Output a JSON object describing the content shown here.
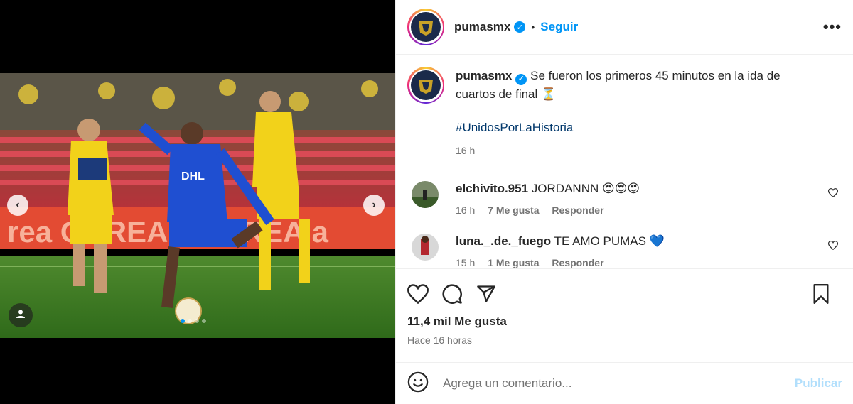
{
  "post": {
    "username": "pumasmx",
    "follow_label": "Seguir",
    "separator": "•",
    "more_label": "•••",
    "caption": "Se fueron los primeros 45 minutos en la ida de cuartos de final ⏳",
    "hashtag": "#UnidosPorLaHistoria",
    "caption_time": "16 h",
    "likes": "11,4 mil Me gusta",
    "time_ago": "Hace 16 horas"
  },
  "media": {
    "prev_label": "‹",
    "next_label": "›",
    "slide_count": 4,
    "active_slide": 1
  },
  "comments": [
    {
      "username": "elchivito.951",
      "text": "JORDANNN 😍😍😍",
      "time": "16 h",
      "likes": "7 Me gusta",
      "reply": "Responder"
    },
    {
      "username": "luna._.de._fuego",
      "text": "TE AMO PUMAS 💙",
      "time": "15 h",
      "likes": "1 Me gusta",
      "reply": "Responder"
    }
  ],
  "add_comment": {
    "placeholder": "Agrega un comentario...",
    "post_label": "Publicar"
  },
  "colors": {
    "accent": "#0095f6",
    "hashtag": "#00376b",
    "muted": "#737373",
    "post_disabled": "#b2dffc"
  }
}
